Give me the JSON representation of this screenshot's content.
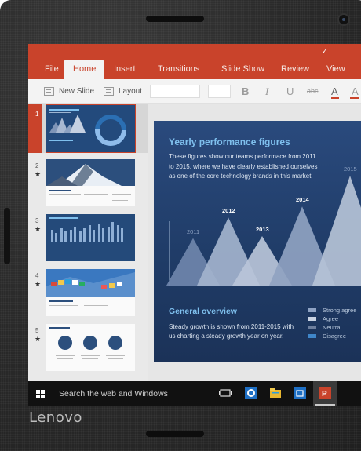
{
  "device": {
    "brand": "Lenovo"
  },
  "ribbon": {
    "tabs": [
      "File",
      "Home",
      "Insert",
      "Transitions",
      "Slide Show",
      "Review",
      "View"
    ],
    "active_tab": "Home",
    "new_slide_label": "New Slide",
    "layout_label": "Layout",
    "bold_label": "B",
    "italic_label": "I",
    "underline_label": "U",
    "strikethrough_label": "abc",
    "font_color_label": "A",
    "highlight_label": "A"
  },
  "slides_panel": {
    "items": [
      {
        "number": "1",
        "star": ""
      },
      {
        "number": "2",
        "star": "★"
      },
      {
        "number": "3",
        "star": "★"
      },
      {
        "number": "4",
        "star": "★"
      },
      {
        "number": "5",
        "star": "★"
      }
    ],
    "selected": 1
  },
  "slide": {
    "title": "Yearly performance figures",
    "body": "These figures show our teams performace from 2011 to 2015, where we have clearly established ourselves as one of the core technology brands in this market.",
    "subtitle": "General overview",
    "body2": "Steady growth is shown from 2011-2015 with us charting a steady growth year on year.",
    "chart_data": {
      "type": "area",
      "categories": [
        "2011",
        "2012",
        "2013",
        "2014",
        "2015"
      ],
      "series": [
        {
          "name": "",
          "values": [
            43,
            62,
            45,
            72,
            100
          ]
        }
      ]
    },
    "legend": [
      {
        "label": "Strong agree",
        "color": "#8fa3c4"
      },
      {
        "label": "Agree",
        "color": "#c9d3e3"
      },
      {
        "label": "Neutral",
        "color": "#6d7f9e"
      },
      {
        "label": "Disagree",
        "color": "#3f86c9"
      }
    ]
  },
  "taskbar": {
    "search_placeholder": "Search the web and Windows",
    "colors": {
      "accent": "#c9432b",
      "taskbar": "#111111"
    }
  }
}
